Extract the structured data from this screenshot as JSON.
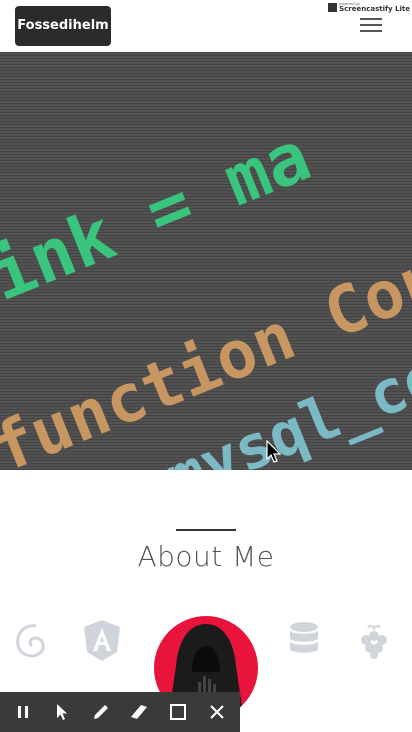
{
  "header": {
    "brand": "Fossedihelm",
    "badge_small": "powered by",
    "badge_name": "Screencastify Lite"
  },
  "hero": {
    "code_lines": [
      "link = ma",
      "function Con",
      "mysql_co"
    ]
  },
  "about": {
    "title": "About Me"
  },
  "tech_icons": [
    "debian-icon",
    "angular-icon",
    "avatar",
    "database-icon",
    "raspberry-pi-icon"
  ],
  "colors": {
    "avatar_bg": "#e8143c",
    "code_green": "#3fd68a",
    "code_pink": "#e78b9b",
    "code_blue": "#86c9d6",
    "code_orange": "#d8a36a"
  },
  "recording_toolbar": {
    "tools": [
      "pause-icon",
      "pointer-icon",
      "pen-icon",
      "eraser-icon",
      "rectangle-icon",
      "close-icon"
    ]
  }
}
